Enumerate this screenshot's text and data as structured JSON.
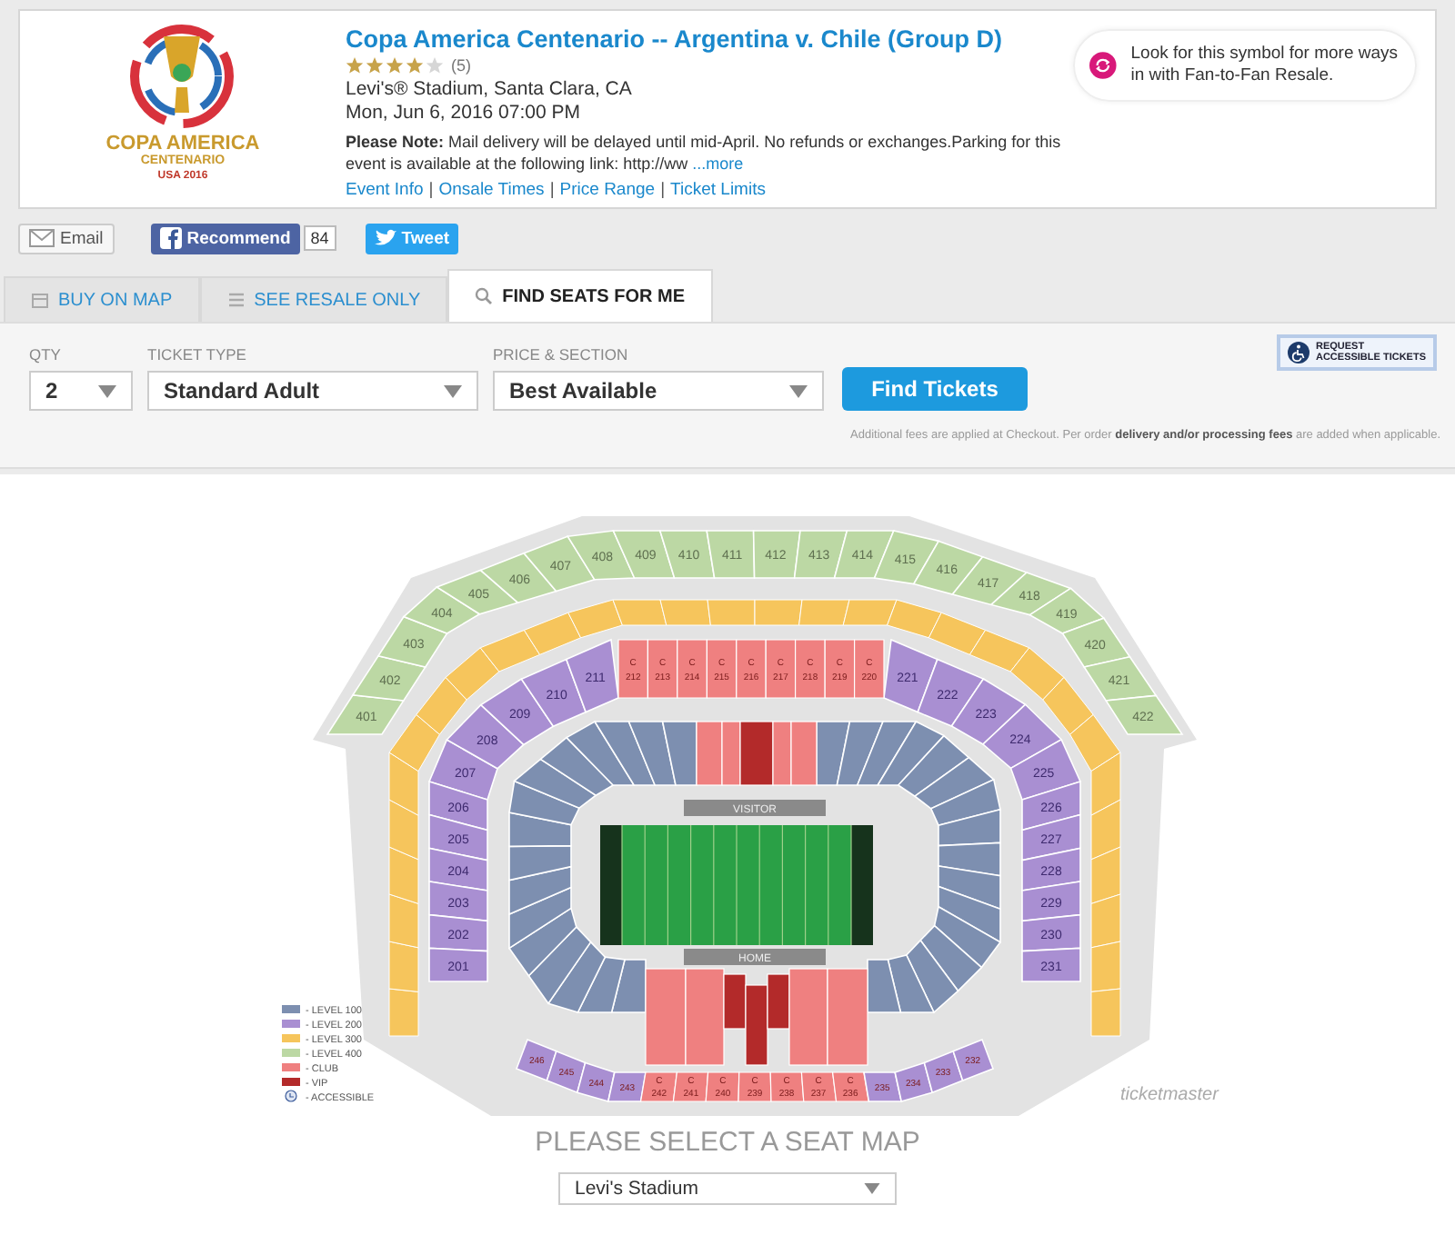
{
  "event": {
    "logo_lines": [
      "COPA AMERICA",
      "CENTENARIO",
      "USA 2016"
    ],
    "title": "Copa America Centenario -- Argentina v. Chile (Group D)",
    "stars": 4,
    "rating_count": "(5)",
    "venue": "Levi's® Stadium, Santa Clara, CA",
    "date": "Mon, Jun 6, 2016 07:00 PM",
    "note": "**Please Note:** Mail delivery will be delayed until mid-April. No refunds or exchanges.Parking for this event is available at the following link: http://ww",
    "more_link": "...more",
    "links": [
      "Event Info",
      "Onsale Times",
      "Price Range",
      "Ticket Limits"
    ],
    "link_separator": "|",
    "resale_tip": "Look for this symbol for more ways in with Fan-to-Fan Resale."
  },
  "social": {
    "email": "Email",
    "recommend": "Recommend",
    "recommend_count": "84",
    "tweet": "Tweet"
  },
  "tabs": [
    {
      "label": "BUY ON MAP",
      "selected": false
    },
    {
      "label": "SEE RESALE ONLY",
      "selected": false
    },
    {
      "label": "FIND SEATS FOR ME",
      "selected": true
    }
  ],
  "form": {
    "fields": [
      {
        "label": "QTY",
        "value": "2"
      },
      {
        "label": "TICKET TYPE",
        "value": "Standard Adult"
      },
      {
        "label": "PRICE & SECTION",
        "value": "Best Available"
      }
    ],
    "submit": "Find Tickets",
    "accessible_lines": [
      "REQUEST",
      "ACCESSIBLE TICKETS"
    ],
    "fee_note": "Additional fees are applied at Checkout. Per order **delivery and/or processing fees** are added when applicable."
  },
  "map": {
    "level_400": [
      "401",
      "402",
      "403",
      "404",
      "405",
      "406",
      "407",
      "408",
      "409",
      "410",
      "411",
      "412",
      "413",
      "414",
      "415",
      "416",
      "417",
      "418",
      "419",
      "420",
      "421",
      "422"
    ],
    "level_200_left_arc": [
      "207",
      "208",
      "209",
      "210",
      "211"
    ],
    "level_200_left_column": [
      "206",
      "205",
      "204",
      "203",
      "202",
      "201"
    ],
    "club_top": [
      {
        "tag": "C",
        "label": "212"
      },
      {
        "tag": "C",
        "label": "213"
      },
      {
        "tag": "C",
        "label": "214"
      },
      {
        "tag": "C",
        "label": "215"
      },
      {
        "tag": "C",
        "label": "216"
      },
      {
        "tag": "C",
        "label": "217"
      },
      {
        "tag": "C",
        "label": "218"
      },
      {
        "tag": "C",
        "label": "219"
      },
      {
        "tag": "C",
        "label": "220"
      }
    ],
    "level_200_right_arc": [
      "221",
      "222",
      "223",
      "224",
      "225"
    ],
    "level_200_right_column": [
      "226",
      "227",
      "228",
      "229",
      "230",
      "231"
    ],
    "bottom_row": [
      {
        "kind": "level",
        "label": "246"
      },
      {
        "kind": "level",
        "label": "245"
      },
      {
        "kind": "level",
        "label": "244"
      },
      {
        "kind": "level",
        "label": "243"
      },
      {
        "kind": "club",
        "tag": "C",
        "label": "242"
      },
      {
        "kind": "club",
        "tag": "C",
        "label": "241"
      },
      {
        "kind": "club",
        "tag": "C",
        "label": "240"
      },
      {
        "kind": "club",
        "tag": "C",
        "label": "239"
      },
      {
        "kind": "club",
        "tag": "C",
        "label": "238"
      },
      {
        "kind": "club",
        "tag": "C",
        "label": "237"
      },
      {
        "kind": "club",
        "tag": "C",
        "label": "236"
      },
      {
        "kind": "level",
        "label": "235"
      },
      {
        "kind": "level",
        "label": "234"
      },
      {
        "kind": "level",
        "label": "233"
      },
      {
        "kind": "level",
        "label": "232"
      }
    ],
    "visitor_label": "VISITOR",
    "home_label": "HOME",
    "legend": [
      {
        "kind": "swatch",
        "label": "- LEVEL 100",
        "color": "#7d8fb0"
      },
      {
        "kind": "swatch",
        "label": "- LEVEL 200",
        "color": "#a98fd2"
      },
      {
        "kind": "swatch",
        "label": "- LEVEL 300",
        "color": "#f6c55c"
      },
      {
        "kind": "swatch",
        "label": "- LEVEL 400",
        "color": "#bcd8a4"
      },
      {
        "kind": "swatch",
        "label": "- CLUB",
        "color": "#ef8080"
      },
      {
        "kind": "swatch",
        "label": "- VIP",
        "color": "#b32a2a"
      },
      {
        "kind": "accessible",
        "label": "- ACCESSIBLE"
      }
    ],
    "brand": "ticketmaster"
  },
  "seat_map": {
    "heading": "PLEASE SELECT A SEAT MAP",
    "value": "Levi's Stadium"
  }
}
